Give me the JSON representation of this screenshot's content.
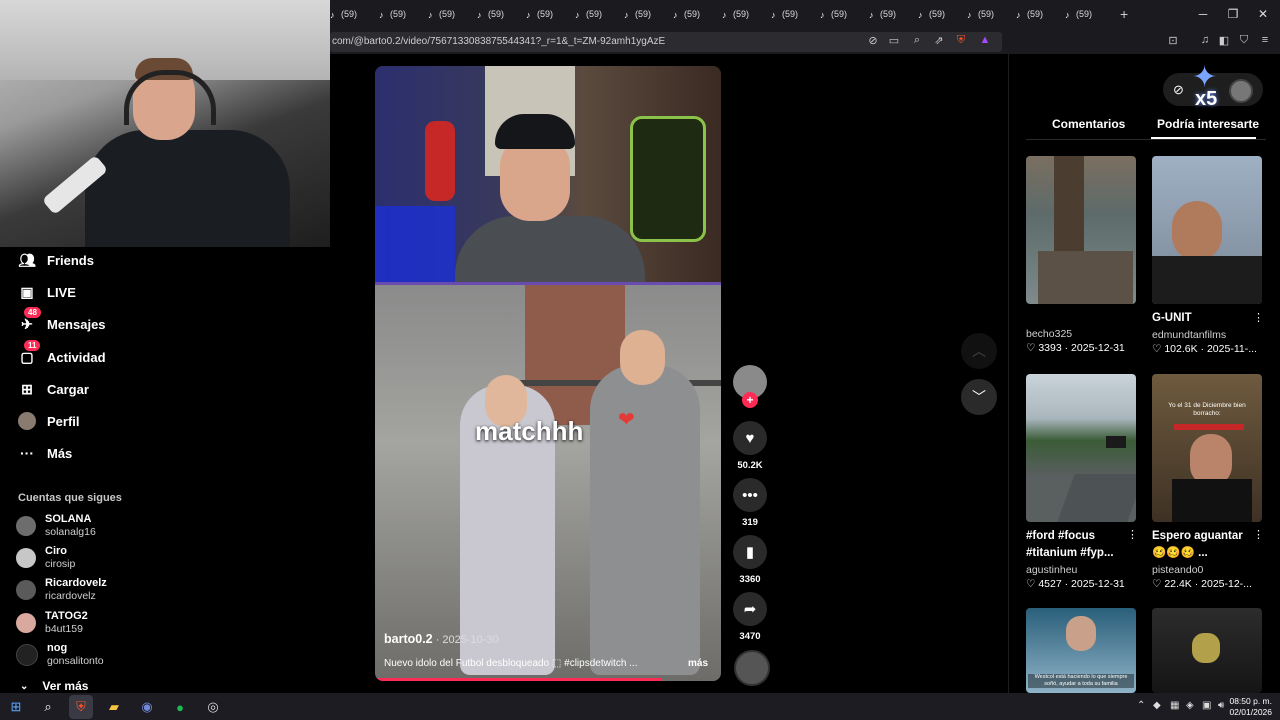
{
  "browser": {
    "tabs": [
      {
        "label": "(59)"
      },
      {
        "label": "(59)"
      },
      {
        "label": "(59)"
      },
      {
        "label": "(59)"
      },
      {
        "label": "(59)"
      },
      {
        "label": "(59)"
      },
      {
        "label": "(59)"
      },
      {
        "label": "(59)"
      },
      {
        "label": "(59)"
      },
      {
        "label": "(59)"
      },
      {
        "label": "(59)"
      },
      {
        "label": "(59)"
      },
      {
        "label": "(59)"
      },
      {
        "label": "(59)"
      },
      {
        "label": "(59)"
      },
      {
        "label": "(59)"
      }
    ],
    "tab_icon": "tiktok-icon",
    "new_tab": "+",
    "url": "com/@barto0.2/video/7567133083875544341?_r=1&_t=ZM-92amh1ygAzE"
  },
  "sidebar": {
    "items": [
      {
        "label": "Friends",
        "icon": "friends-icon",
        "badge": ""
      },
      {
        "label": "LIVE",
        "icon": "live-icon",
        "badge": ""
      },
      {
        "label": "Mensajes",
        "icon": "messages-icon",
        "badge": "48"
      },
      {
        "label": "Actividad",
        "icon": "activity-icon",
        "badge": "11"
      },
      {
        "label": "Cargar",
        "icon": "upload-icon",
        "badge": ""
      },
      {
        "label": "Perfil",
        "icon": "profile-avatar",
        "badge": ""
      },
      {
        "label": "Más",
        "icon": "more-icon",
        "badge": ""
      }
    ],
    "following_title": "Cuentas que sigues",
    "following": [
      {
        "name": "SOLANA",
        "handle": "solanalg16"
      },
      {
        "name": "Ciro",
        "handle": "cirosip"
      },
      {
        "name": "Ricardovelz",
        "handle": "ricardovelz"
      },
      {
        "name": "TATOG2",
        "handle": "b4ut159"
      },
      {
        "name": "nog",
        "handle": "gonsalitonto"
      }
    ],
    "see_more": "Ver más"
  },
  "video": {
    "overlay_text": "matchhh",
    "author": "barto0.2",
    "date": " · 2025-10-30",
    "description": "Nuevo idolo del Futbol desbloqueado ⬚ #clipsdetwitch ...",
    "more": "más",
    "progress": 0.83
  },
  "actions": {
    "likes": "50.2K",
    "comments": "319",
    "saves": "3360",
    "shares": "3470"
  },
  "right_panel": {
    "tabs": [
      "Comentarios",
      "Podría interesarte"
    ],
    "active_tab": "Podría interesarte",
    "overlay_badge": "x5",
    "cards": [
      {
        "title": "",
        "user": "becho325",
        "likes": "3393",
        "date": "2025-12-31"
      },
      {
        "title": "G-UNIT",
        "user": "edmundtanfilms",
        "likes": "102.6K",
        "date": "2025-11-..."
      },
      {
        "title": "#ford #focus",
        "title2": "#titanium #fyp...",
        "user": "agustinheu",
        "likes": "4527",
        "date": "2025-12-31"
      },
      {
        "title": "Espero aguantar",
        "title2": "🥴🥴🥴 ...",
        "user": "pisteando0",
        "likes": "22.4K",
        "date": "2025-12-..."
      }
    ],
    "thumb_caption_4": "Yo el 31 de Diciembre bien borracho:",
    "thumb_caption_5": "Westcol está haciendo lo que siempre soñó, ayudar a toda su familia"
  },
  "taskbar": {
    "time": "08:50 p. m.",
    "date": "02/01/2026"
  },
  "colors": {
    "accent": "#fe2c55",
    "bg": "#000000"
  }
}
